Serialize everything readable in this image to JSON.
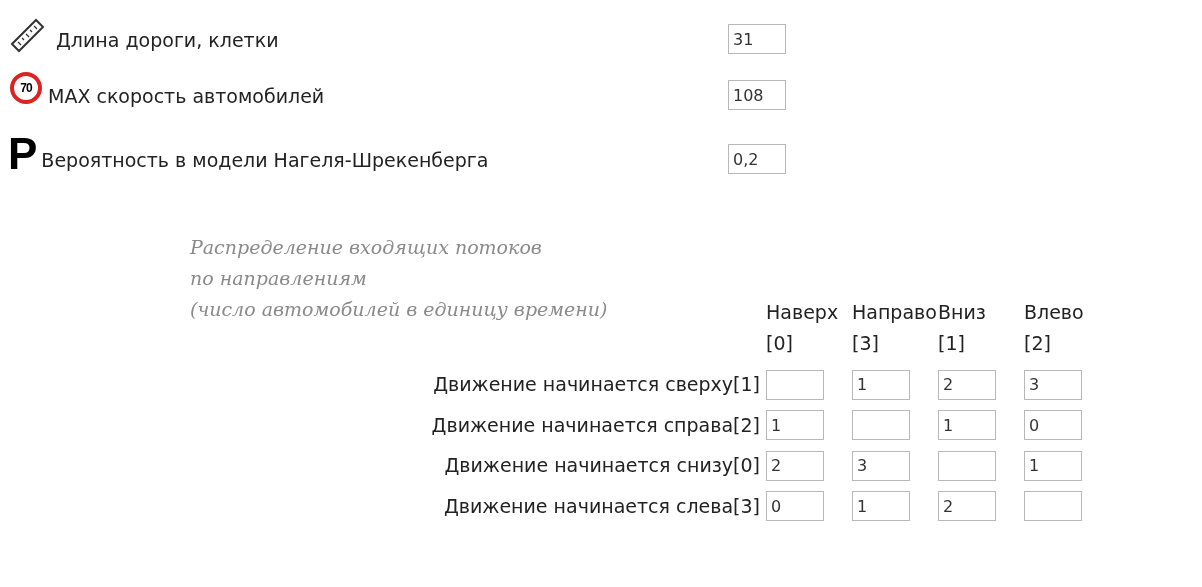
{
  "parameters": [
    {
      "kind": "ruler",
      "label": "Длина дороги, клетки",
      "value": "31"
    },
    {
      "kind": "speed-sign",
      "sign_text": "70",
      "label": "MAX скорость автомобилей",
      "value": "108"
    },
    {
      "kind": "letter",
      "letter": "P",
      "label": "Вероятность в модели Нагеля-Шрекенберга",
      "value": "0,2"
    }
  ],
  "flow_matrix": {
    "caption": [
      "Распределение входящих потоков",
      "по направлениям",
      "(число автомобилей в единицу времени)"
    ],
    "columns": [
      {
        "name": "Наверх",
        "index": "[0]"
      },
      {
        "name": "Направо",
        "index": "[3]"
      },
      {
        "name": "Вниз",
        "index": "[1]"
      },
      {
        "name": "Влево",
        "index": "[2]"
      }
    ],
    "rows": [
      {
        "label": "Движение начинается сверху[1]",
        "cells": [
          {},
          {
            "value": "1"
          },
          {
            "value": "2"
          },
          {
            "value": "3"
          }
        ]
      },
      {
        "label": "Движение начинается справа[2]",
        "cells": [
          {
            "value": "1"
          },
          {},
          {
            "value": "1"
          },
          {
            "value": "0"
          }
        ]
      },
      {
        "label": "Движение начинается снизу[0]",
        "cells": [
          {
            "value": "2"
          },
          {
            "value": "3"
          },
          {},
          {
            "value": "1"
          }
        ]
      },
      {
        "label": "Движение начинается слева[3]",
        "cells": [
          {
            "value": "0"
          },
          {
            "value": "1"
          },
          {
            "value": "2"
          },
          {}
        ]
      }
    ]
  }
}
